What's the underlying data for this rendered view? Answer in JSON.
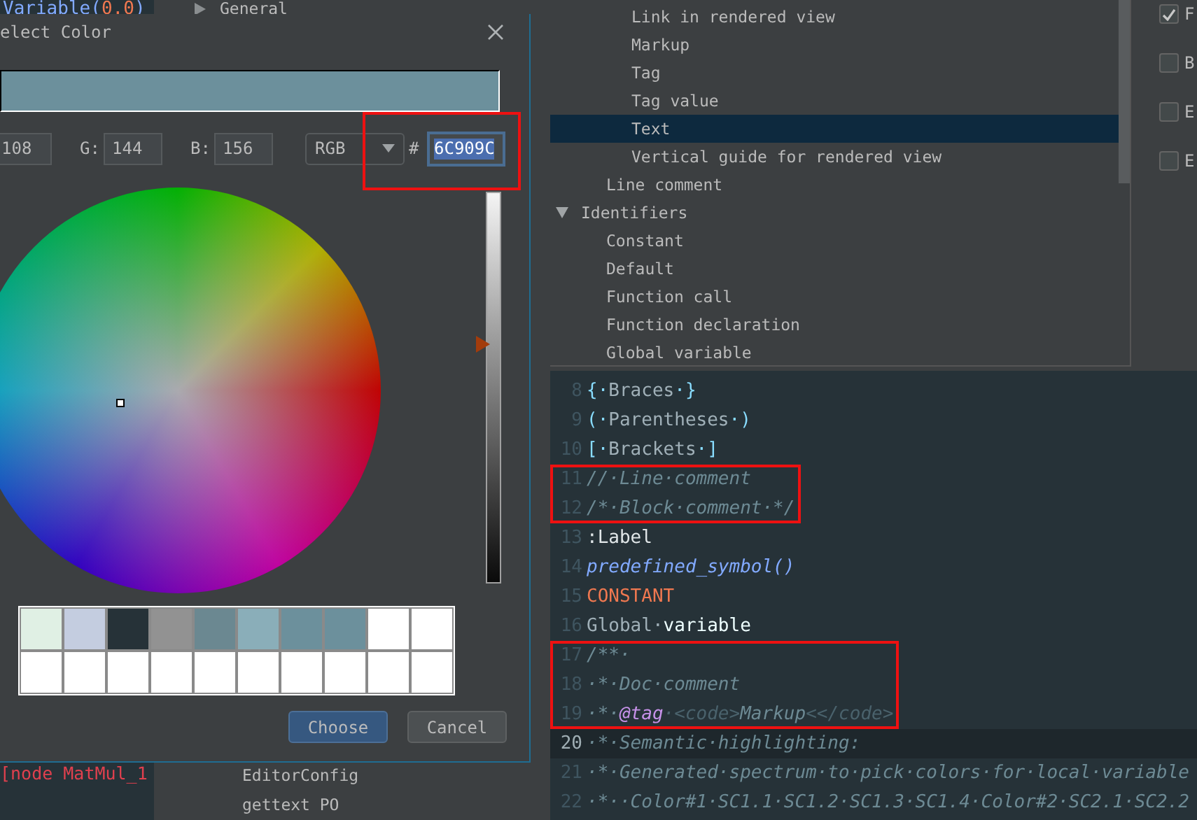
{
  "left_editor": {
    "top_line": [
      {
        "text": "Variable(",
        "kind": "name"
      },
      {
        "text": "0.0",
        "kind": "number"
      },
      {
        "text": ")",
        "kind": "name"
      }
    ],
    "bottom_line": "[node MatMul_1"
  },
  "settings_list": {
    "items": [
      {
        "label": "General",
        "expanded": false
      },
      {
        "children": [
          {
            "label": "EditorConfig"
          },
          {
            "label": "gettext PO"
          }
        ]
      }
    ]
  },
  "color_dialog": {
    "title": "elect Color",
    "red": "108",
    "green_label": "G:",
    "green": "144",
    "blue_label": "B:",
    "blue": "156",
    "mode": "RGB",
    "hash_label": "#",
    "hex": "6C909C",
    "hex_boxed": true,
    "value_slider": {
      "level": 0.61
    },
    "swatches": [
      {
        "color": "#e0f0e4"
      },
      {
        "color": "#c4cde0"
      },
      {
        "color": "#263238"
      },
      {
        "color": "#929292"
      },
      {
        "color": "#6b8891"
      },
      {
        "color": "#8aaeb9"
      },
      {
        "color": "#6c909c"
      },
      {
        "color": "#6c909c"
      },
      {
        "color": "#ffffff"
      },
      {
        "color": "#ffffff"
      },
      {
        "color": "#ffffff"
      },
      {
        "color": "#ffffff"
      },
      {
        "color": "#ffffff"
      },
      {
        "color": "#ffffff"
      },
      {
        "color": "#ffffff"
      },
      {
        "color": "#ffffff"
      },
      {
        "color": "#ffffff"
      },
      {
        "color": "#ffffff"
      },
      {
        "color": "#ffffff"
      },
      {
        "color": "#ffffff"
      }
    ],
    "buttons": [
      {
        "label": "Choose",
        "kind": "primary"
      },
      {
        "label": "Cancel",
        "kind": "secondary"
      }
    ]
  },
  "tree": {
    "items": [
      {
        "children": [
          {
            "children": [
              {
                "label": "Link in rendered view",
                "selected": false
              },
              {
                "label": "Markup",
                "selected": false
              },
              {
                "label": "Tag",
                "selected": false
              },
              {
                "label": "Tag value",
                "selected": false
              },
              {
                "label": "Text",
                "selected": true
              },
              {
                "label": "Vertical guide for rendered view",
                "selected": false
              }
            ]
          },
          {
            "label": "Line comment",
            "selected": false
          }
        ]
      },
      {
        "label": "Identifiers",
        "expanded": true,
        "selected": false,
        "children": [
          {
            "label": "Constant",
            "selected": false
          },
          {
            "label": "Default",
            "selected": false
          },
          {
            "label": "Function call",
            "selected": false
          },
          {
            "label": "Function declaration",
            "selected": false
          },
          {
            "label": "Global variable",
            "selected": false
          }
        ]
      }
    ]
  },
  "options": [
    {
      "label": "F",
      "checked": true
    },
    {
      "label": "B",
      "checked": false
    },
    {
      "label": "E",
      "checked": false
    },
    {
      "label": "E",
      "checked": false
    }
  ],
  "code": {
    "lines": [
      {
        "number": "8",
        "current": false,
        "boxed": false,
        "tokens": [
          {
            "text": "{·",
            "kind": "brace"
          },
          {
            "text": "Braces",
            "kind": "plain"
          },
          {
            "text": "·}",
            "kind": "brace"
          }
        ]
      },
      {
        "number": "9",
        "current": false,
        "boxed": false,
        "tokens": [
          {
            "text": "(·",
            "kind": "brace"
          },
          {
            "text": "Parentheses",
            "kind": "plain"
          },
          {
            "text": "·)",
            "kind": "brace"
          }
        ]
      },
      {
        "number": "10",
        "current": false,
        "boxed": false,
        "tokens": [
          {
            "text": "[·",
            "kind": "brace"
          },
          {
            "text": "Brackets",
            "kind": "plain"
          },
          {
            "text": "·]",
            "kind": "brace"
          }
        ]
      },
      {
        "number": "11",
        "current": false,
        "boxed": true,
        "tokens": [
          {
            "text": "//·Line·comment",
            "kind": "comment"
          }
        ]
      },
      {
        "number": "12",
        "current": false,
        "boxed": true,
        "tokens": [
          {
            "text": "/*·Block·comment·*/",
            "kind": "comment"
          }
        ]
      },
      {
        "number": "13",
        "current": false,
        "boxed": false,
        "tokens": [
          {
            "text": ":Label",
            "kind": "label"
          }
        ]
      },
      {
        "number": "14",
        "current": false,
        "boxed": false,
        "tokens": [
          {
            "text": "predefined_symbol()",
            "kind": "predefined"
          }
        ]
      },
      {
        "number": "15",
        "current": false,
        "boxed": false,
        "tokens": [
          {
            "text": "CONSTANT",
            "kind": "constant"
          }
        ]
      },
      {
        "number": "16",
        "current": false,
        "boxed": false,
        "tokens": [
          {
            "text": "Global·",
            "kind": "plain"
          },
          {
            "text": "variable",
            "kind": "variable"
          }
        ]
      },
      {
        "number": "17",
        "current": false,
        "boxed": true,
        "tokens": [
          {
            "text": "/**·",
            "kind": "comment"
          }
        ]
      },
      {
        "number": "18",
        "current": false,
        "boxed": true,
        "tokens": [
          {
            "text": "·*·Doc·comment",
            "kind": "comment"
          }
        ]
      },
      {
        "number": "19",
        "current": false,
        "boxed": true,
        "tokens": [
          {
            "text": "·*·",
            "kind": "comment"
          },
          {
            "text": "@tag",
            "kind": "tag"
          },
          {
            "text": "·<code>",
            "kind": "markup"
          },
          {
            "text": "Markup",
            "kind": "comment"
          },
          {
            "text": "<</code>",
            "kind": "markup"
          }
        ]
      },
      {
        "number": "20",
        "current": true,
        "boxed": false,
        "tokens": [
          {
            "text": "·*·Semantic·highlighting:",
            "kind": "comment"
          }
        ]
      },
      {
        "number": "21",
        "current": false,
        "boxed": false,
        "tokens": [
          {
            "text": "·*·Generated·spectrum·to·pick·colors·for·local·variable",
            "kind": "comment"
          }
        ]
      },
      {
        "number": "22",
        "current": false,
        "boxed": false,
        "tokens": [
          {
            "text": "·*··Color#1·SC1.1·SC1.2·SC1.3·SC1.4·Color#2·SC2.1·SC2.2",
            "kind": "comment"
          }
        ]
      }
    ]
  }
}
